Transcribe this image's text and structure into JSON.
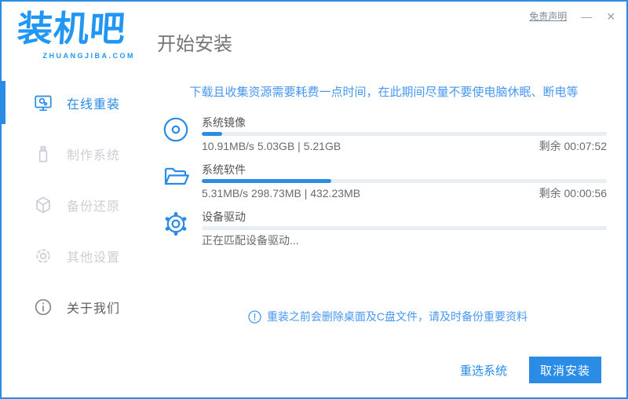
{
  "window": {
    "logo": {
      "brand": "装机吧",
      "domain": "ZHUANGJIBA.COM"
    },
    "title": "开始安装",
    "disclaimer_link": "免责声明",
    "minimize_glyph": "—",
    "close_glyph": "✕"
  },
  "sidebar": {
    "items": [
      {
        "label": "在线重装",
        "icon": "monitor-icon",
        "state": "active"
      },
      {
        "label": "制作系统",
        "icon": "usb-drive-icon",
        "state": "disabled"
      },
      {
        "label": "备份还原",
        "icon": "backup-cube-icon",
        "state": "disabled"
      },
      {
        "label": "其他设置",
        "icon": "gear-icon",
        "state": "disabled"
      },
      {
        "label": "关于我们",
        "icon": "info-icon",
        "state": "normal"
      }
    ]
  },
  "main": {
    "notice": "下载且收集资源需要耗费一点时间，在此期间尽量不要使电脑休眠、断电等",
    "tasks": [
      {
        "title": "系统镜像",
        "icon": "disc-icon",
        "detail": "10.91MB/s 5.03GB | 5.21GB",
        "remaining": "剩余 00:07:52",
        "progress_percent": 5
      },
      {
        "title": "系统软件",
        "icon": "folder-icon",
        "detail": "5.31MB/s 298.73MB | 432.23MB",
        "remaining": "剩余 00:00:56",
        "progress_percent": 32
      },
      {
        "title": "设备驱动",
        "icon": "gear-icon",
        "detail": "正在匹配设备驱动...",
        "remaining": "",
        "progress_percent": 0
      }
    ],
    "warning_note": "重装之前会删除桌面及C盘文件，请及时备份重要资料"
  },
  "footer": {
    "reselect_label": "重选系统",
    "cancel_label": "取消安装"
  },
  "colors": {
    "accent_blue": "#2b8ce6",
    "logo_blue": "#2196f3",
    "notice_blue": "#4797f1",
    "track_gray": "#e9eef5",
    "inactive_gray": "#cbcfd6"
  }
}
